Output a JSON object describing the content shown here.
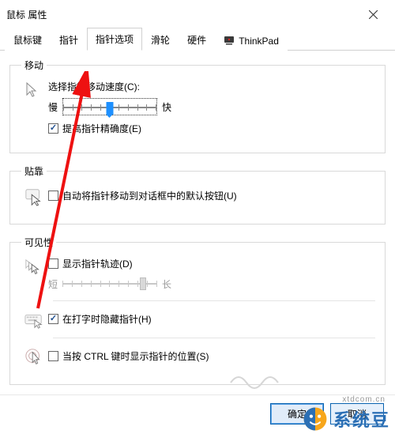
{
  "window": {
    "title": "鼠标 属性"
  },
  "tabs": {
    "items": [
      {
        "label": "鼠标键"
      },
      {
        "label": "指针"
      },
      {
        "label": "指针选项"
      },
      {
        "label": "滑轮"
      },
      {
        "label": "硬件"
      },
      {
        "label": "ThinkPad"
      }
    ],
    "activeIndex": 2
  },
  "groups": {
    "motion": {
      "legend": "移动",
      "speed_label": "选择指针移动速度(C):",
      "slow": "慢",
      "fast": "快",
      "slider_value": 50,
      "precision_checked": true,
      "precision_label": "提高指针精确度(E)"
    },
    "snap": {
      "legend": "贴靠",
      "auto_move_checked": false,
      "auto_move_label": "自动将指针移动到对话框中的默认按钮(U)"
    },
    "visibility": {
      "legend": "可见性",
      "trails_checked": false,
      "trails_label": "显示指针轨迹(D)",
      "short": "短",
      "long": "长",
      "trails_slider_value": 85,
      "hide_typing_checked": true,
      "hide_typing_label": "在打字时隐藏指针(H)",
      "ctrl_locate_checked": false,
      "ctrl_locate_label": "当按 CTRL 键时显示指针的位置(S)"
    }
  },
  "buttons": {
    "ok": "确定",
    "cancel": "取消"
  },
  "watermark": {
    "text": "系统豆",
    "sub": "xtdcom.cn"
  }
}
